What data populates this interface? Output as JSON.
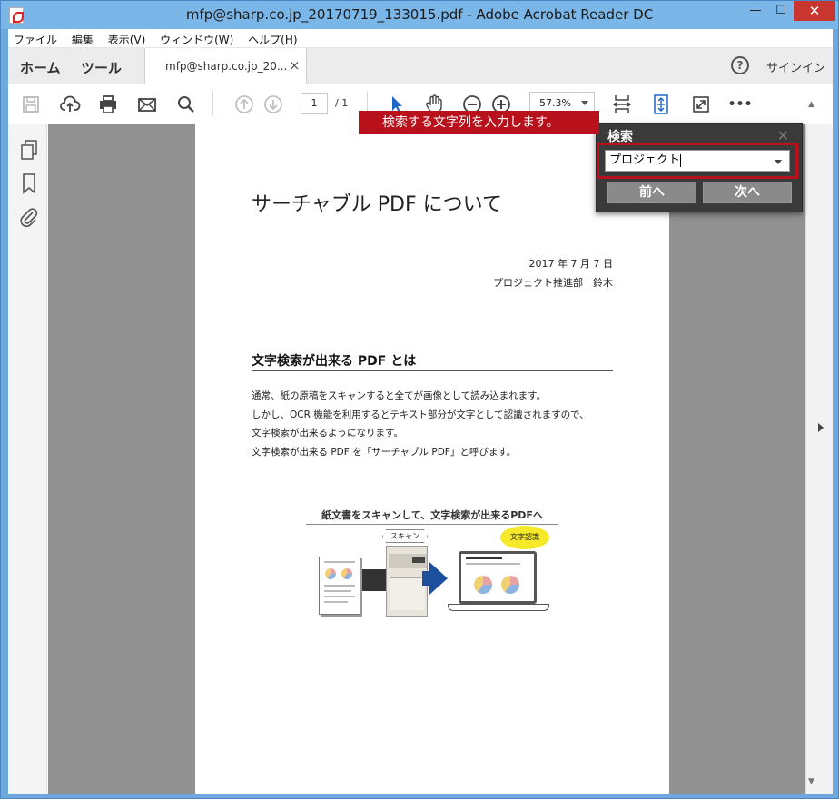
{
  "window": {
    "title": "mfp@sharp.co.jp_20170719_133015.pdf - Adobe Acrobat Reader DC",
    "minimize": "—",
    "maximize": "☐",
    "close": "✕"
  },
  "menu": [
    "ファイル",
    "編集",
    "表示(V)",
    "ウィンドウ(W)",
    "ヘルプ(H)"
  ],
  "tabs": {
    "home": "ホーム",
    "tools": "ツール",
    "document": "mfp@sharp.co.jp_20...",
    "close": "×",
    "help": "?",
    "signin": "サインイン"
  },
  "toolbar": {
    "page_current": "1",
    "page_total": "/ 1",
    "zoom": "57.3%",
    "more": "•••"
  },
  "document": {
    "title": "サーチャブル PDF について",
    "date": "2017 年 7 月 7 日",
    "author": "プロジェクト推進部　鈴木",
    "heading": "文字検索が出来る PDF とは",
    "paragraph": [
      "通常、紙の原稿をスキャンすると全てが画像として読み込まれます。",
      "しかし、OCR 機能を利用するとテキスト部分が文字として認識されますので、",
      "文字検索が出来るようになります。",
      "文字検索が出来る PDF を「サーチャブル PDF」と呼びます。"
    ],
    "figure_caption": "紙文書をスキャンして、文字検索が出来るPDFへ",
    "scan_label": "スキャン",
    "ocr_label": "文字認識"
  },
  "search": {
    "title": "検索",
    "close": "✕",
    "value": "プロジェクト",
    "prev": "前へ",
    "next": "次へ"
  },
  "callout": "検索する文字列を入力します。",
  "colors": {
    "callout_red": "#b8111c",
    "panel_dark": "#3a3a3a",
    "doc_background": "#919191",
    "titlebar": "#7bb6e8"
  },
  "icons": [
    "save-icon",
    "cloud-upload-icon",
    "print-icon",
    "mail-icon",
    "search-icon",
    "prev-page-icon",
    "next-page-icon",
    "select-cursor-icon",
    "hand-icon",
    "zoom-out-icon",
    "zoom-in-icon",
    "fit-page-icon",
    "scroll-mode-icon",
    "fullscreen-icon",
    "more-icon",
    "pages-icon",
    "bookmark-icon",
    "attachment-icon"
  ]
}
